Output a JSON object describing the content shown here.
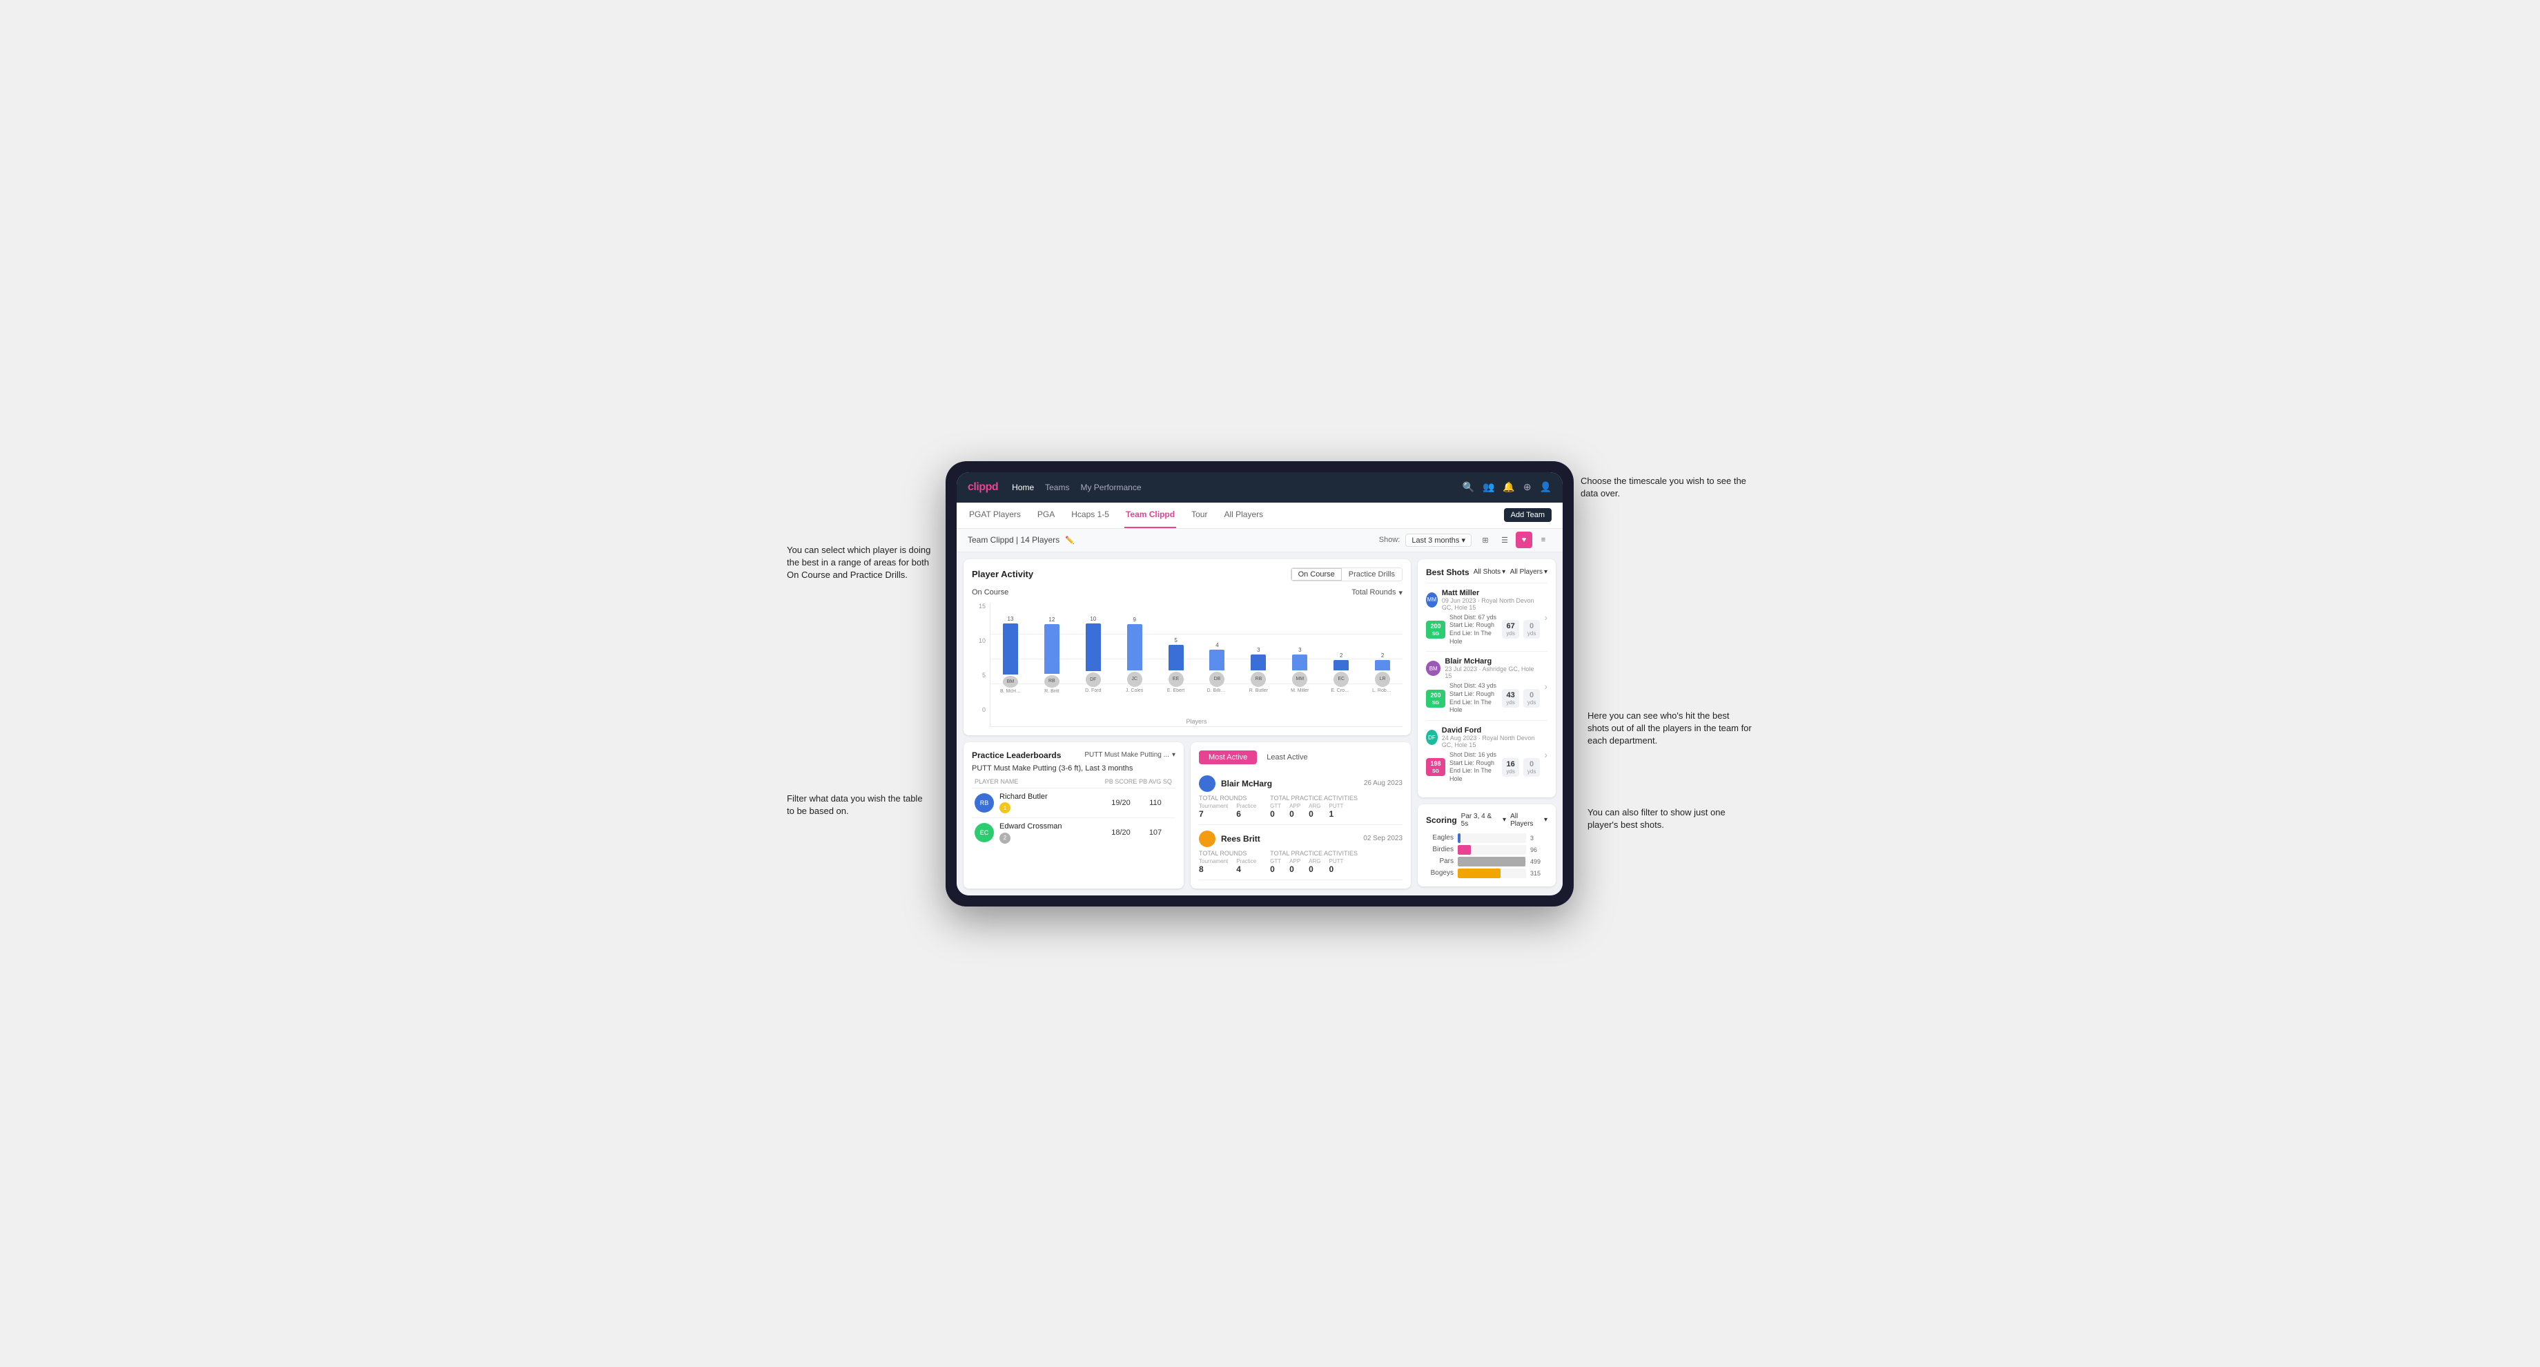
{
  "annotations": {
    "top_right": "Choose the timescale you wish to see the data over.",
    "left_1": "You can select which player is doing the best in a range of areas for both On Course and Practice Drills.",
    "left_2": "Filter what data you wish the table to be based on.",
    "right_1": "Here you can see who's hit the best shots out of all the players in the team for each department.",
    "right_2": "You can also filter to show just one player's best shots."
  },
  "nav": {
    "logo": "clippd",
    "items": [
      "Home",
      "Teams",
      "My Performance"
    ],
    "active": "Teams"
  },
  "sub_nav": {
    "items": [
      "PGAT Players",
      "PGA",
      "Hcaps 1-5",
      "Team Clippd",
      "Tour",
      "All Players"
    ],
    "active": "Team Clippd",
    "add_team_btn": "Add Team"
  },
  "team_header": {
    "name": "Team Clippd | 14 Players",
    "show_label": "Show:",
    "time_period": "Last 3 months"
  },
  "player_activity": {
    "title": "Player Activity",
    "toggle_on_course": "On Course",
    "toggle_practice": "Practice Drills",
    "active_toggle": "On Course",
    "section_title": "On Course",
    "chart_filter": "Total Rounds",
    "x_axis_label": "Players",
    "bars": [
      {
        "name": "B. McHarg",
        "value": 13,
        "highlight": 13
      },
      {
        "name": "R. Britt",
        "value": 12,
        "highlight": 12
      },
      {
        "name": "D. Ford",
        "value": 10,
        "highlight": 10
      },
      {
        "name": "J. Coles",
        "value": 9,
        "highlight": 9
      },
      {
        "name": "E. Ebert",
        "value": 5,
        "highlight": 5
      },
      {
        "name": "D. Billingham",
        "value": 4,
        "highlight": 4
      },
      {
        "name": "R. Butler",
        "value": 3,
        "highlight": 3
      },
      {
        "name": "M. Miller",
        "value": 3,
        "highlight": 3
      },
      {
        "name": "E. Crossman",
        "value": 2,
        "highlight": 2
      },
      {
        "name": "L. Robertson",
        "value": 2,
        "highlight": 2
      }
    ],
    "y_axis": [
      "15",
      "10",
      "5",
      "0"
    ]
  },
  "practice_leaderboards": {
    "title": "Practice Leaderboards",
    "selector": "PUTT Must Make Putting ...",
    "drill_name": "PUTT Must Make Putting (3-6 ft), Last 3 months",
    "cols": [
      "PLAYER NAME",
      "PB SCORE",
      "PB AVG SQ"
    ],
    "rows": [
      {
        "name": "Richard Butler",
        "rank": 1,
        "rank_type": "gold",
        "pb_score": "19/20",
        "pb_avg": "110"
      },
      {
        "name": "Edward Crossman",
        "rank": 2,
        "rank_type": "silver",
        "pb_score": "18/20",
        "pb_avg": "107"
      }
    ]
  },
  "most_active": {
    "tabs": [
      "Most Active",
      "Least Active"
    ],
    "active_tab": "Most Active",
    "players": [
      {
        "name": "Blair McHarg",
        "date": "26 Aug 2023",
        "total_rounds_label": "Total Rounds",
        "tournament": 7,
        "practice": 6,
        "practice_activities_label": "Total Practice Activities",
        "gtt": 0,
        "app": 0,
        "arg": 0,
        "putt": 1
      },
      {
        "name": "Rees Britt",
        "date": "02 Sep 2023",
        "total_rounds_label": "Total Rounds",
        "tournament": 8,
        "practice": 4,
        "practice_activities_label": "Total Practice Activities",
        "gtt": 0,
        "app": 0,
        "arg": 0,
        "putt": 0
      }
    ]
  },
  "best_shots": {
    "title": "Best Shots",
    "filter_label": "All Shots",
    "players_filter": "All Players",
    "shots": [
      {
        "player": "Matt Miller",
        "date": "09 Jun 2023",
        "course": "Royal North Devon GC",
        "hole": "Hole 15",
        "badge": "200",
        "badge_sub": "SG",
        "dist_label": "Shot Dist: 67 yds",
        "lie_start": "Start Lie: Rough",
        "lie_end": "End Lie: In The Hole",
        "dist_value": "67",
        "dist_unit": "yds",
        "zero_value": "0",
        "zero_unit": "yds"
      },
      {
        "player": "Blair McHarg",
        "date": "23 Jul 2023",
        "course": "Ashridge GC",
        "hole": "Hole 15",
        "badge": "200",
        "badge_sub": "SG",
        "dist_label": "Shot Dist: 43 yds",
        "lie_start": "Start Lie: Rough",
        "lie_end": "End Lie: In The Hole",
        "dist_value": "43",
        "dist_unit": "yds",
        "zero_value": "0",
        "zero_unit": "yds"
      },
      {
        "player": "David Ford",
        "date": "24 Aug 2023",
        "course": "Royal North Devon GC",
        "hole": "Hole 15",
        "badge": "198",
        "badge_sub": "SG",
        "dist_label": "Shot Dist: 16 yds",
        "lie_start": "Start Lie: Rough",
        "lie_end": "End Lie: In The Hole",
        "dist_value": "16",
        "dist_unit": "yds",
        "zero_value": "0",
        "zero_unit": "yds"
      }
    ]
  },
  "scoring": {
    "title": "Scoring",
    "filter": "Par 3, 4 & 5s",
    "players": "All Players",
    "rows": [
      {
        "label": "Eagles",
        "count": 3,
        "max": 500,
        "type": "eagles"
      },
      {
        "label": "Birdies",
        "count": 96,
        "max": 500,
        "type": "birdies"
      },
      {
        "label": "Pars",
        "count": 499,
        "max": 500,
        "type": "pars"
      },
      {
        "label": "Bogeys",
        "count": 315,
        "max": 500,
        "type": "bogeys"
      }
    ]
  }
}
